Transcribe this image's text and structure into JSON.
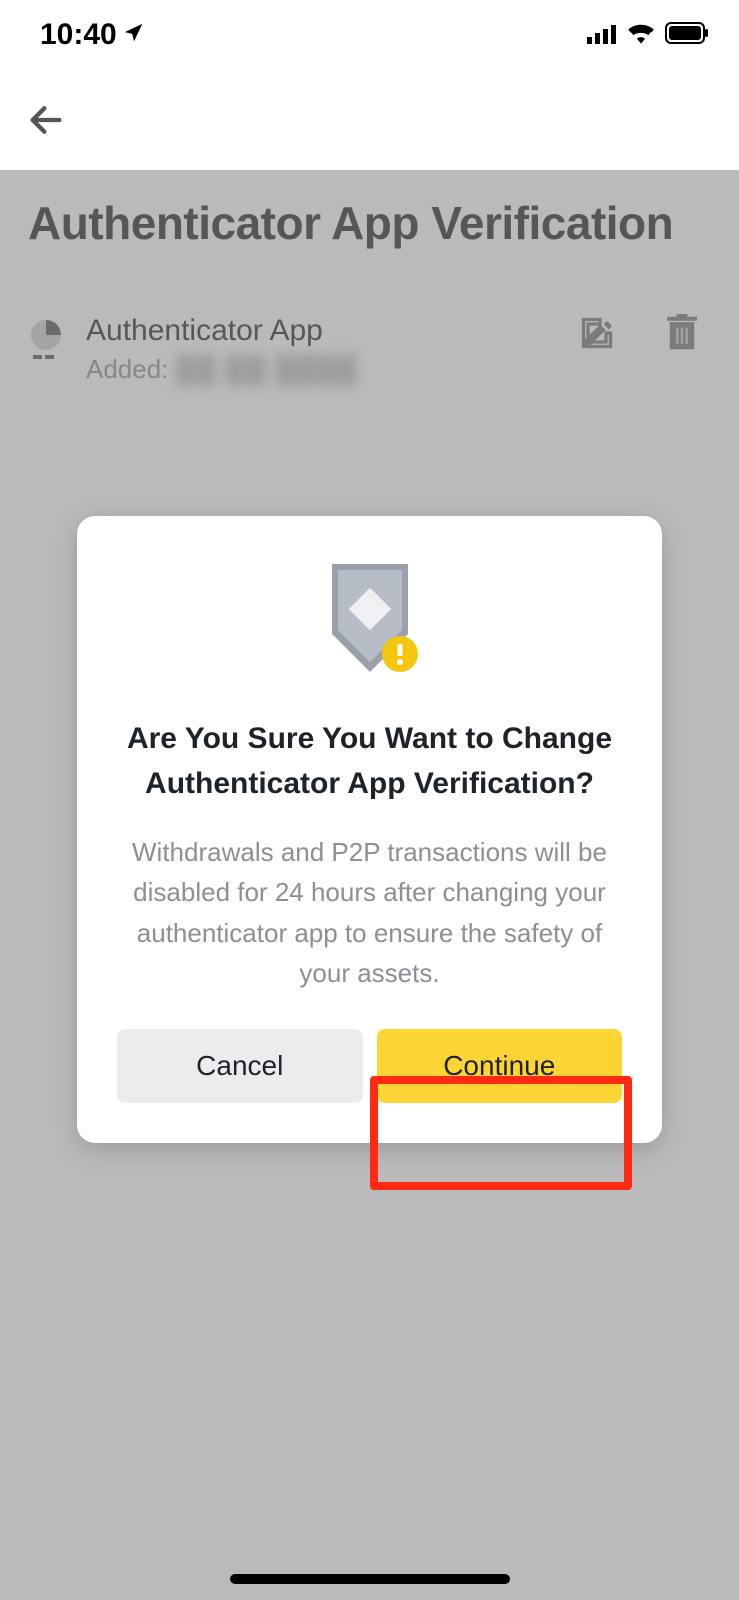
{
  "statusbar": {
    "time": "10:40"
  },
  "page": {
    "title": "Authenticator App Verification",
    "item": {
      "title": "Authenticator App",
      "added_label": "Added:",
      "added_value": "██ ██ ████"
    }
  },
  "modal": {
    "title": "Are You Sure You Want to Change Authenticator App Verification?",
    "body": "Withdrawals and P2P transactions will be disabled for 24 hours after changing your authenticator app to ensure the safety of your assets.",
    "cancel": "Cancel",
    "continue": "Continue"
  }
}
